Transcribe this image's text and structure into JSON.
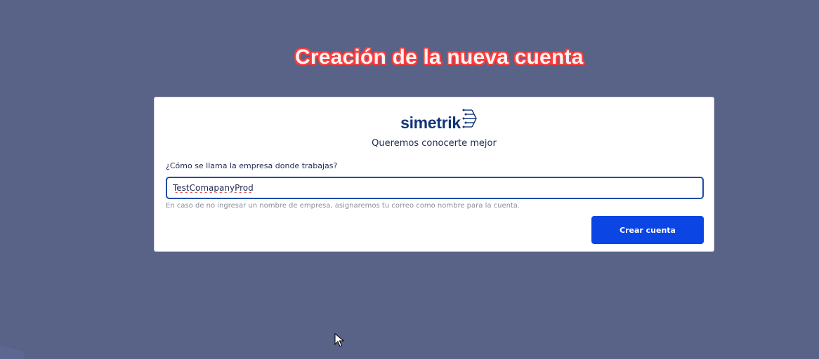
{
  "annotation": {
    "text": "Creación de la nueva cuenta"
  },
  "card": {
    "logo_text": "simetrik",
    "logo_icon": "simetrik-mark-icon",
    "subtitle": "Queremos conocerte mejor",
    "field_label": "¿Cómo se llama la empresa donde trabajas?",
    "company_input_value": "TestComapanyProd",
    "helper_text": "En caso de no ingresar un nombre de empresa, asignaremos tu correo como nombre para la cuenta.",
    "submit_label": "Crear cuenta"
  },
  "colors": {
    "background": "#596287",
    "brand": "#12357a",
    "primary_button": "#0b45e3",
    "annotation_outline": "#ff3b3b"
  }
}
